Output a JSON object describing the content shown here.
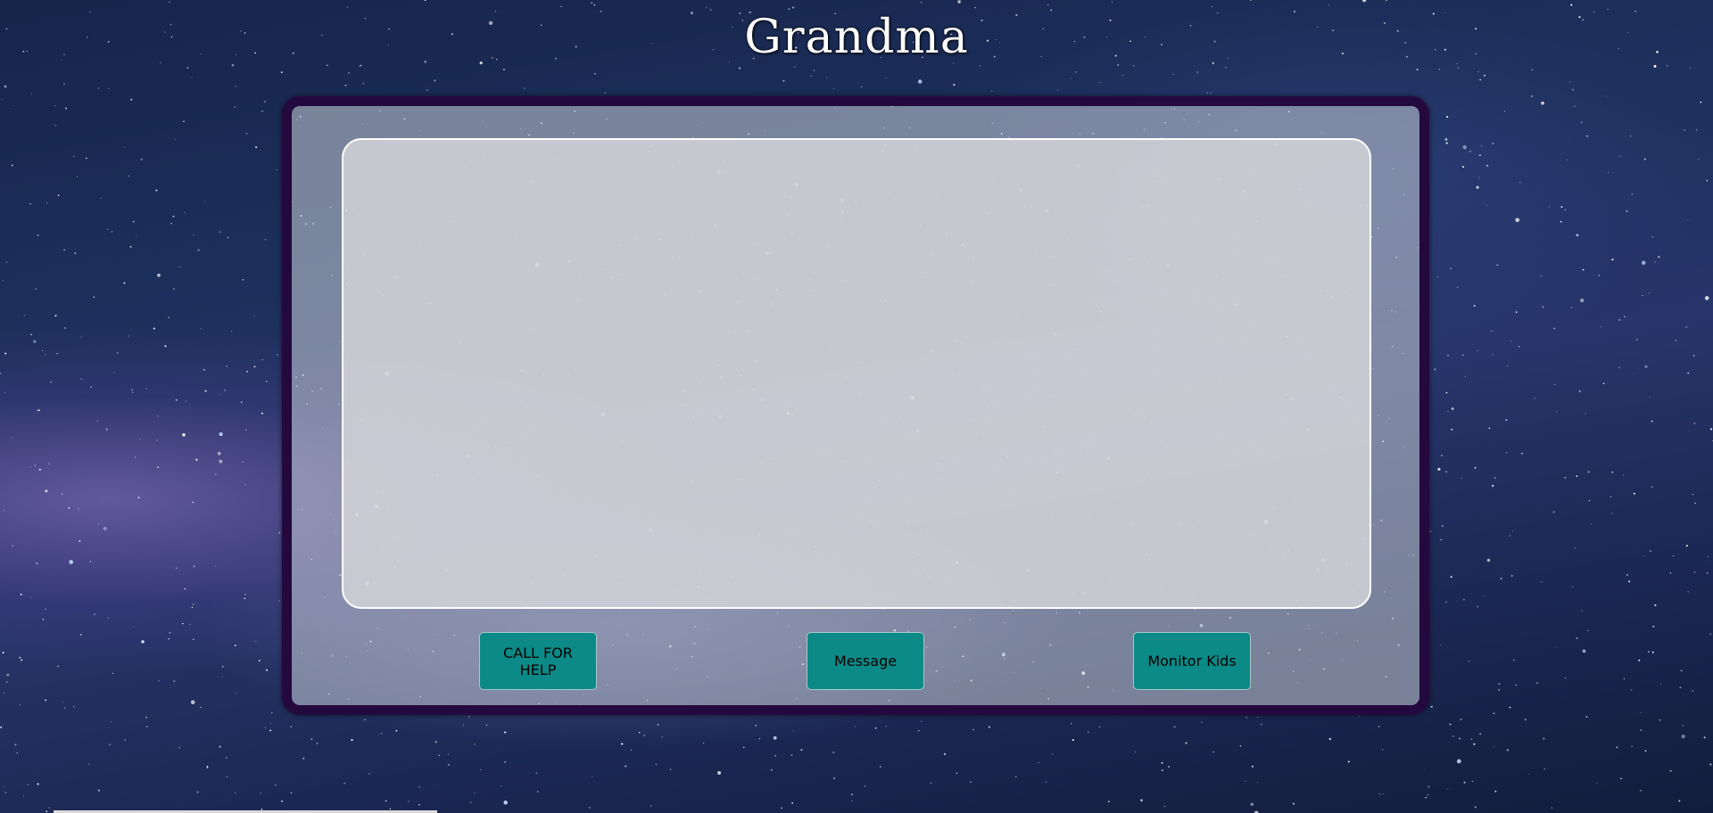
{
  "header": {
    "title": "Grandma"
  },
  "actions": {
    "call_for_help": "CALL FOR HELP",
    "message": "Message",
    "monitor_kids": "Monitor Kids"
  },
  "colors": {
    "frame_border": "#24093f",
    "button_fill": "#0b8a87",
    "background": "#1d2f5c"
  }
}
